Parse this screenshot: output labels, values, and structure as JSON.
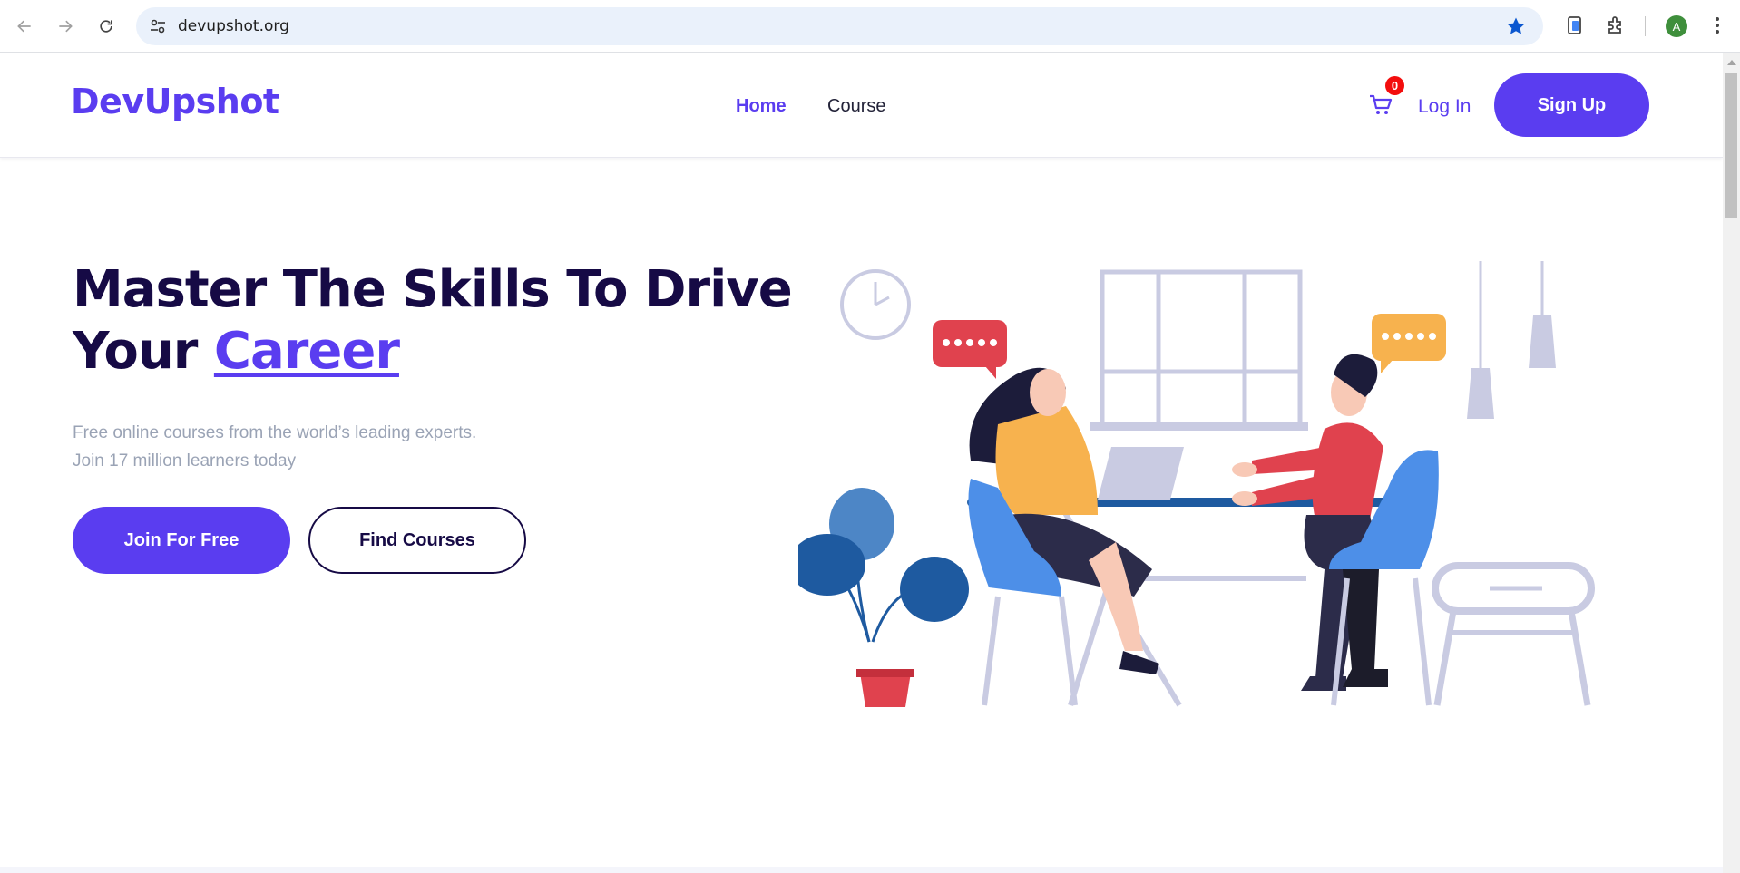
{
  "browser": {
    "url": "devupshot.org",
    "profile_initial": "A",
    "icons": [
      "back-arrow-icon",
      "forward-arrow-icon",
      "reload-icon",
      "site-settings-icon",
      "bookmark-star-icon",
      "tab-search-icon",
      "extensions-icon",
      "profile-icon",
      "more-menu-icon"
    ]
  },
  "header": {
    "logo": "DevUpshot",
    "menu": {
      "home": "Home",
      "course": "Course"
    },
    "cart_count": "0",
    "login": "Log In",
    "signup": "Sign Up"
  },
  "hero": {
    "title_line1": "Master The Skills To Drive",
    "title_line2_prefix": "Your ",
    "title_accent": "Career",
    "subtitle_line1": "Free online courses from the world’s leading experts.",
    "subtitle_line2": "Join 17 million learners today",
    "btn_join": "Join For Free",
    "btn_find": "Find Courses"
  },
  "colors": {
    "brand": "#5a3df0",
    "title": "#160a45",
    "subtitle": "#9aa3b5",
    "badge": "#f30d0d"
  }
}
